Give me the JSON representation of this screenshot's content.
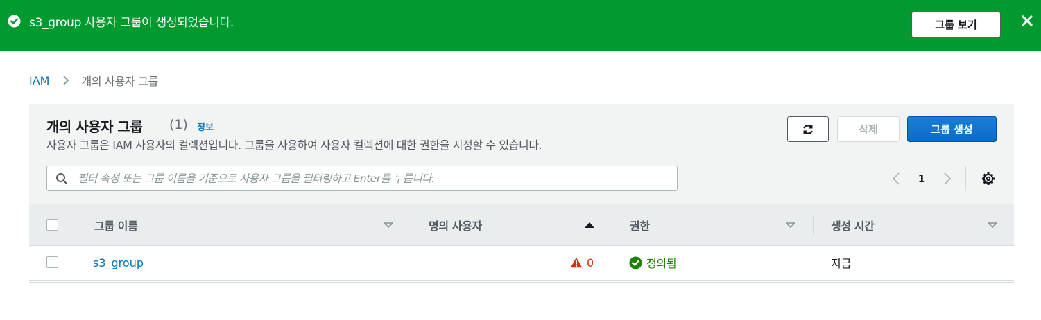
{
  "flash": {
    "message": "s3_group 사용자 그룹이 생성되었습니다.",
    "view_button": "그룹 보기",
    "color": "#009a2e"
  },
  "breadcrumb": {
    "root": "IAM",
    "current": "개의 사용자 그룹"
  },
  "panel": {
    "title": "개의 사용자 그룹",
    "count": "(1)",
    "info_link": "정보",
    "description": "사용자 그룹은 IAM 사용자의 컬렉션입니다. 그룹을 사용하여 사용자 컬렉션에 대한 권한을 지정할 수 있습니다.",
    "buttons": {
      "refresh_icon": "refresh-icon",
      "delete": "삭제",
      "create": "그룹 생성"
    },
    "search": {
      "placeholder": "필터 속성 또는 그룹 이름을 기준으로 사용자 그룹을 필터링하고 Enter를 누릅니다.",
      "value": ""
    },
    "pagination": {
      "current_page": "1"
    }
  },
  "table": {
    "columns": [
      {
        "label": "그룹 이름",
        "sort": "none"
      },
      {
        "label": "명의 사용자",
        "sort": "ascending"
      },
      {
        "label": "권한",
        "sort": "none"
      },
      {
        "label": "생성 시간",
        "sort": "none"
      }
    ],
    "rows": [
      {
        "group_name": "s3_group",
        "users": "0",
        "permissions": "정의됨",
        "created": "지금"
      }
    ]
  },
  "colors": {
    "accent": "#0073bb",
    "primary_button": "#0b6bc6",
    "warning": "#d13212",
    "success": "#1d8102"
  }
}
